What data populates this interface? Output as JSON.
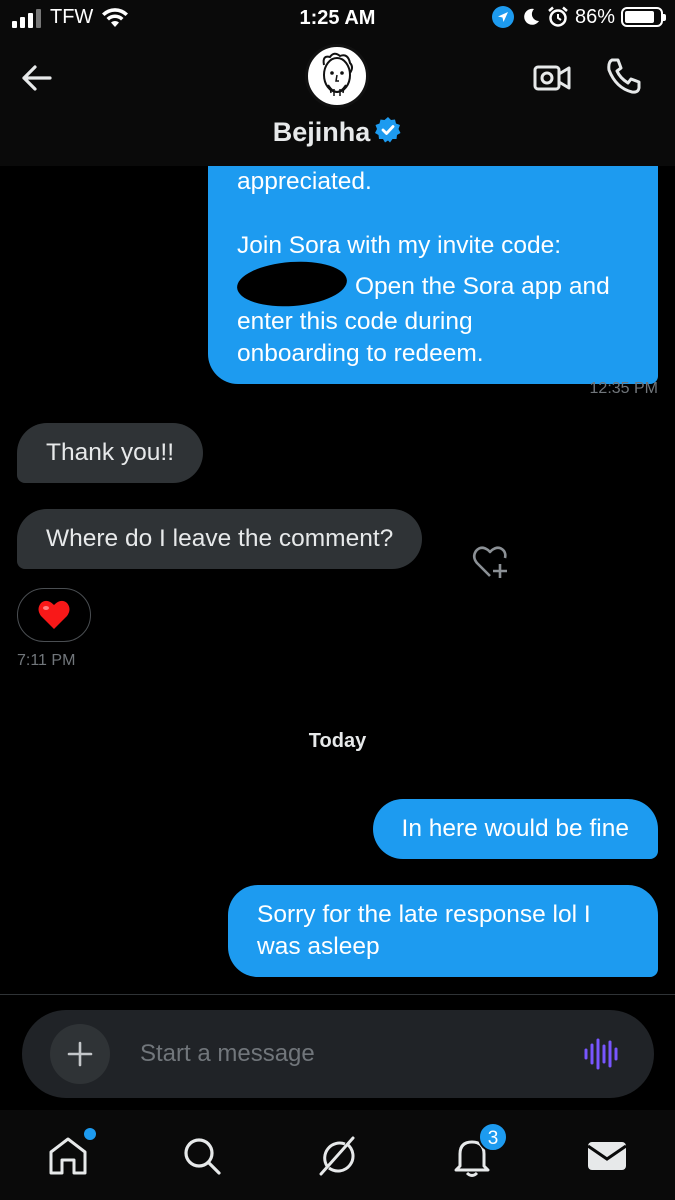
{
  "status_bar": {
    "carrier": "TFW",
    "time": "1:25 AM",
    "battery": "86%",
    "battery_level": 0.86
  },
  "header": {
    "contact_name": "Bejinha",
    "verified": true
  },
  "messages": {
    "invite_line1": "appreciated.",
    "invite_line2": "Join Sora with my invite code:",
    "invite_line3": "Open the Sora app and",
    "invite_line4": "enter this code during",
    "invite_line5": "onboarding to redeem.",
    "ts_1": "12:35 PM",
    "recv_1": "Thank you!!",
    "recv_2": "Where do I leave the comment?",
    "reaction": "❤️",
    "ts_2": "7:11 PM",
    "day_separator": "Today",
    "sent_1": "In here would be fine",
    "sent_2": "Sorry for the late response lol I was asleep"
  },
  "composer": {
    "placeholder": "Start a message"
  },
  "tab_bar": {
    "notifications_badge": "3"
  },
  "colors": {
    "accent": "#1d9bf0",
    "received_bubble": "#2f3336",
    "voice_icon": "#7856ff"
  }
}
